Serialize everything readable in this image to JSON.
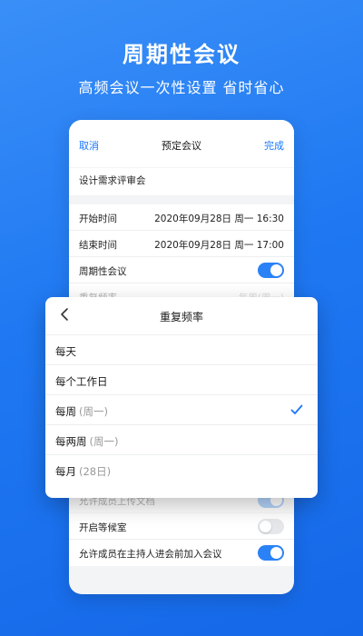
{
  "hero": {
    "title": "周期性会议",
    "subtitle": "高频会议一次性设置 省时省心"
  },
  "nav": {
    "cancel": "取消",
    "title": "预定会议",
    "done": "完成"
  },
  "meeting": {
    "topic": "设计需求评审会",
    "start_label": "开始时间",
    "start_value": "2020年09月28日  周一  16:30",
    "end_label": "结束时间",
    "end_value": "2020年09月28日  周一  17:00",
    "recurring_label": "周期性会议",
    "recurring_on": true,
    "repeat_label_partial": "重复频率",
    "repeat_value_partial": "每周(周一)"
  },
  "lower_settings": {
    "hidden_label_partial": "允许成员上传文档",
    "waiting_room_label": "开启等候室",
    "waiting_room_on": false,
    "join_before_host_label": "允许成员在主持人进会前加入会议",
    "join_before_host_on": true
  },
  "popup": {
    "title": "重复频率",
    "options": [
      {
        "label": "每天",
        "note": "",
        "selected": false
      },
      {
        "label": "每个工作日",
        "note": "",
        "selected": false
      },
      {
        "label": "每周",
        "note": "(周一)",
        "selected": true
      },
      {
        "label": "每两周",
        "note": "(周一)",
        "selected": false
      },
      {
        "label": "每月",
        "note": "(28日)",
        "selected": false
      }
    ]
  },
  "colors": {
    "accent": "#1677ff",
    "background_top": "#3a8ff7",
    "background_bottom": "#1568e8"
  }
}
